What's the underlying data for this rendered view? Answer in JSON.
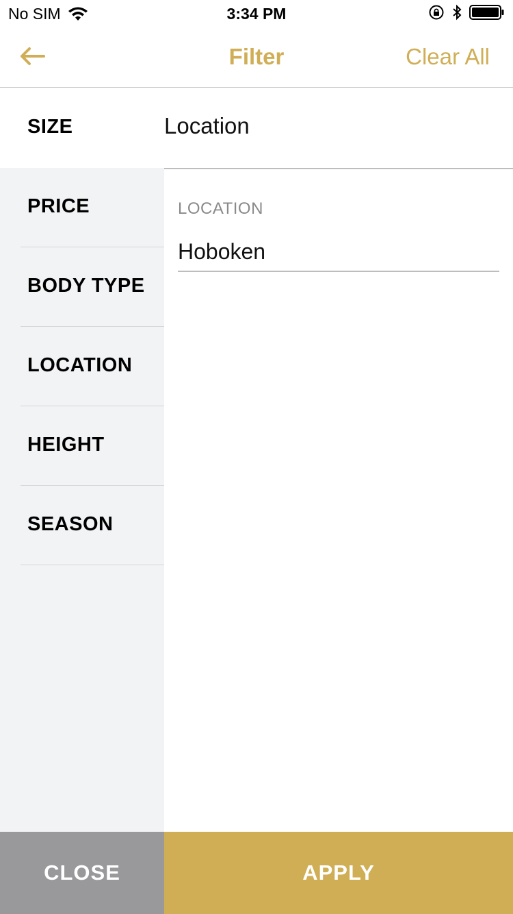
{
  "status_bar": {
    "carrier": "No SIM",
    "time": "3:34 PM"
  },
  "nav": {
    "title": "Filter",
    "clear_label": "Clear All"
  },
  "size_row": {
    "label": "SIZE",
    "value": "Location"
  },
  "sidebar": {
    "items": [
      {
        "label": "PRICE"
      },
      {
        "label": "BODY TYPE"
      },
      {
        "label": "LOCATION"
      },
      {
        "label": "HEIGHT"
      },
      {
        "label": "SEASON"
      }
    ]
  },
  "content": {
    "field_label": "LOCATION",
    "field_value": "Hoboken"
  },
  "buttons": {
    "close_label": "CLOSE",
    "apply_label": "APPLY"
  },
  "colors": {
    "accent": "#d0ae56",
    "close_bg": "#99999b",
    "sidebar_bg": "#f2f3f5"
  }
}
